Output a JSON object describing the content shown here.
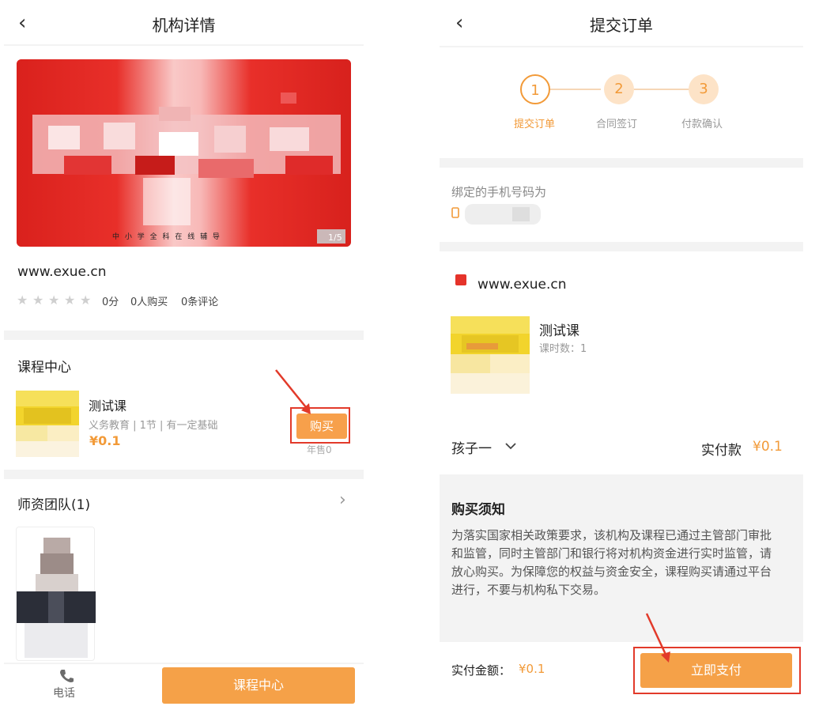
{
  "left": {
    "title": "机构详情",
    "back_glyph": "‹",
    "carousel": {
      "page_indicator": "1/5",
      "caption": "中 小 学 全 科 在 线 辅 导"
    },
    "institution": {
      "name": "www.exue.cn",
      "rating": "0分",
      "purchases": "0人购买",
      "reviews": "0条评论"
    },
    "course_center": {
      "heading": "课程中心",
      "course": {
        "title": "测试课",
        "meta": "义务教育 | 1节 | 有一定基础",
        "price": "¥0.1",
        "sold": "年售0",
        "buy_label": "购买"
      }
    },
    "teachers": {
      "heading": "师资团队(1)",
      "chevron": "›"
    },
    "bottom_bar": {
      "phone_label": "电话",
      "cta_label": "课程中心"
    }
  },
  "right": {
    "title": "提交订单",
    "back_glyph": "‹",
    "steps": [
      {
        "num": "1",
        "label": "提交订单"
      },
      {
        "num": "2",
        "label": "合同签订"
      },
      {
        "num": "3",
        "label": "付款确认"
      }
    ],
    "phone": {
      "label": "绑定的手机号码为"
    },
    "order": {
      "institution": "www.exue.cn",
      "course_title": "测试课",
      "lessons": "课时数：1",
      "child": "孩子一",
      "paid_label": "实付款",
      "paid_value": "¥0.1"
    },
    "notice": {
      "heading": "购买须知",
      "body": "为落实国家相关政策要求，该机构及课程已通过主管部门审批和监管，同时主管部门和银行将对机构资金进行实时监管，请放心购买。为保障您的权益与资金安全，课程购买请通过平台进行，不要与机构私下交易。"
    },
    "footer": {
      "amount_label": "实付金额：",
      "amount_value": "¥0.1",
      "pay_label": "立即支付"
    }
  },
  "colors": {
    "accent": "#f29a38",
    "button": "#f7a04b",
    "highlight": "#e23a2a",
    "banner_red": "#e8241f"
  }
}
